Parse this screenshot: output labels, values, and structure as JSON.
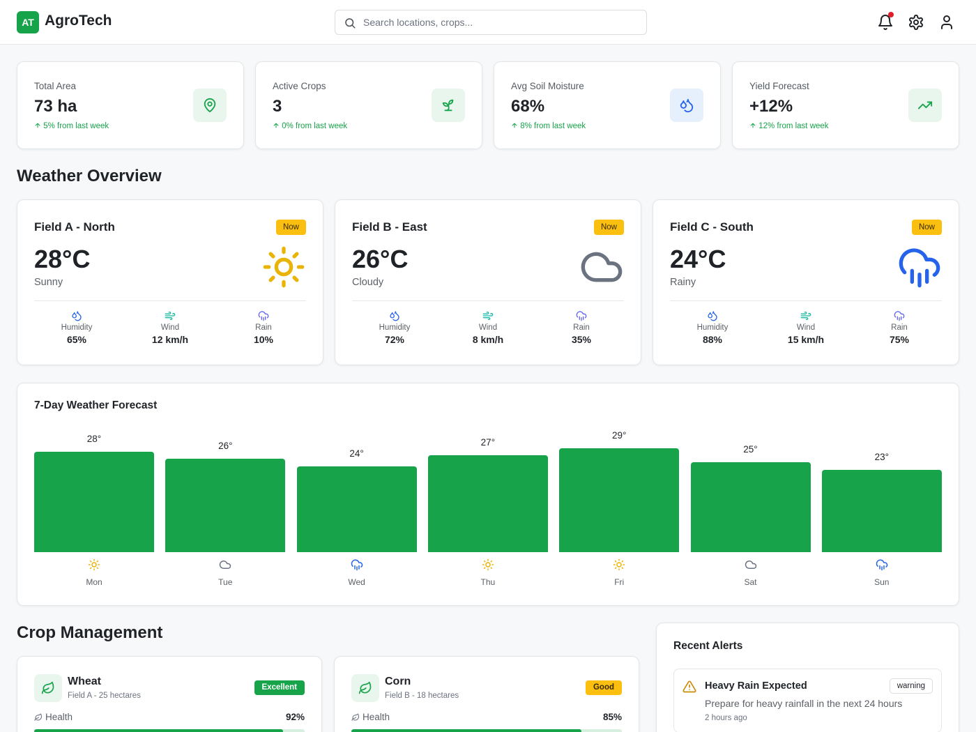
{
  "app": {
    "logo_initials": "AT",
    "name": "AgroTech"
  },
  "search": {
    "placeholder": "Search locations, crops..."
  },
  "header_icons": [
    "bell-icon",
    "gear-icon",
    "user-icon"
  ],
  "colors": {
    "brand_green": "#16a34a",
    "accent_yellow": "#fbbf0f",
    "rain_blue": "#2563eb",
    "notification_red": "#e11d2a"
  },
  "stats": [
    {
      "label": "Total Area",
      "value": "73 ha",
      "change": "5% from last week",
      "icon": "map-pin-icon"
    },
    {
      "label": "Active Crops",
      "value": "3",
      "change": "0% from last week",
      "icon": "sprout-icon"
    },
    {
      "label": "Avg Soil Moisture",
      "value": "68%",
      "change": "8% from last week",
      "icon": "droplets-icon"
    },
    {
      "label": "Yield Forecast",
      "value": "+12%",
      "change": "12% from last week",
      "icon": "trending-up-icon"
    }
  ],
  "weather": {
    "title": "Weather Overview",
    "metric_labels": {
      "humidity": "Humidity",
      "wind": "Wind",
      "rain": "Rain"
    },
    "fields": [
      {
        "name": "Field A - North",
        "badge": "Now",
        "temp": "28°C",
        "condition": "Sunny",
        "icon": "sun-icon",
        "humidity": "65%",
        "wind": "12 km/h",
        "rain": "10%"
      },
      {
        "name": "Field B - East",
        "badge": "Now",
        "temp": "26°C",
        "condition": "Cloudy",
        "icon": "cloud-icon",
        "humidity": "72%",
        "wind": "8 km/h",
        "rain": "35%"
      },
      {
        "name": "Field C - South",
        "badge": "Now",
        "temp": "24°C",
        "condition": "Rainy",
        "icon": "cloud-rain-icon",
        "humidity": "88%",
        "wind": "15 km/h",
        "rain": "75%"
      }
    ]
  },
  "forecast": {
    "title": "7-Day Weather Forecast",
    "days": [
      {
        "day": "Mon",
        "temp": 28,
        "label": "28°",
        "icon": "sun-icon"
      },
      {
        "day": "Tue",
        "temp": 26,
        "label": "26°",
        "icon": "cloud-icon"
      },
      {
        "day": "Wed",
        "temp": 24,
        "label": "24°",
        "icon": "cloud-rain-icon"
      },
      {
        "day": "Thu",
        "temp": 27,
        "label": "27°",
        "icon": "sun-icon"
      },
      {
        "day": "Fri",
        "temp": 29,
        "label": "29°",
        "icon": "sun-icon"
      },
      {
        "day": "Sat",
        "temp": 25,
        "label": "25°",
        "icon": "cloud-icon"
      },
      {
        "day": "Sun",
        "temp": 23,
        "label": "23°",
        "icon": "cloud-rain-icon"
      }
    ]
  },
  "crops": {
    "title": "Crop Management",
    "health_label": "Health",
    "items": [
      {
        "name": "Wheat",
        "sub": "Field A - 25 hectares",
        "badge": "Excellent",
        "badge_color": "#16a34a",
        "health": "92%",
        "health_value": 0.92
      },
      {
        "name": "Corn",
        "sub": "Field B - 18 hectares",
        "badge": "Good",
        "badge_color": "#fbbf0f",
        "health": "85%",
        "health_value": 0.85
      }
    ]
  },
  "alerts": {
    "title": "Recent Alerts",
    "items": [
      {
        "title": "Heavy Rain Expected",
        "tag": "warning",
        "description": "Prepare for heavy rainfall in the next 24 hours",
        "time": "2 hours ago",
        "icon": "alert-triangle-icon"
      }
    ]
  }
}
